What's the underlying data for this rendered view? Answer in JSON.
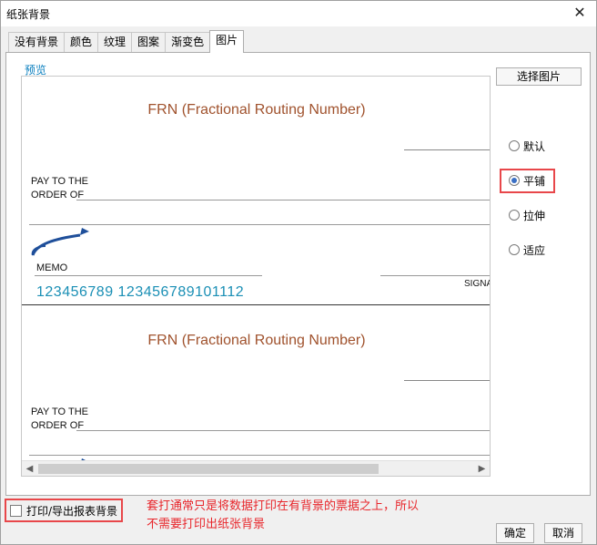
{
  "window": {
    "title": "纸张背景",
    "close_glyph": "✕"
  },
  "tabs": [
    {
      "label": "没有背景"
    },
    {
      "label": "颜色"
    },
    {
      "label": "纹理"
    },
    {
      "label": "图案"
    },
    {
      "label": "渐变色"
    },
    {
      "label": "图片",
      "active": true
    }
  ],
  "preview": {
    "label": "预览",
    "check": {
      "title": "FRN (Fractional Routing Number)",
      "pay_to_line1": "PAY TO THE",
      "pay_to_line2": "ORDER OF",
      "memo": "MEMO",
      "signature": "SIGNA",
      "micr": "123456789  123456789101112"
    }
  },
  "select_image_button": "选择图片",
  "layout_options": {
    "selected": "平铺",
    "options": [
      {
        "label": "默认",
        "checked": false
      },
      {
        "label": "平铺",
        "checked": true
      },
      {
        "label": "拉伸",
        "checked": false
      },
      {
        "label": "适应",
        "checked": false
      }
    ]
  },
  "print_option": {
    "label": "打印/导出报表背景",
    "checked": false
  },
  "annotation": {
    "line1": "套打通常只是将数据打印在有背景的票据之上，所以",
    "line2": "不需要打印出纸张背景"
  },
  "buttons": {
    "ok": "确定",
    "cancel": "取消"
  },
  "colors": {
    "highlight": "#e8474a",
    "annotation_text": "#e8262b",
    "preview_label": "#0a7fbf",
    "frn_title": "#a0522d",
    "micr": "#1a8fb5"
  }
}
